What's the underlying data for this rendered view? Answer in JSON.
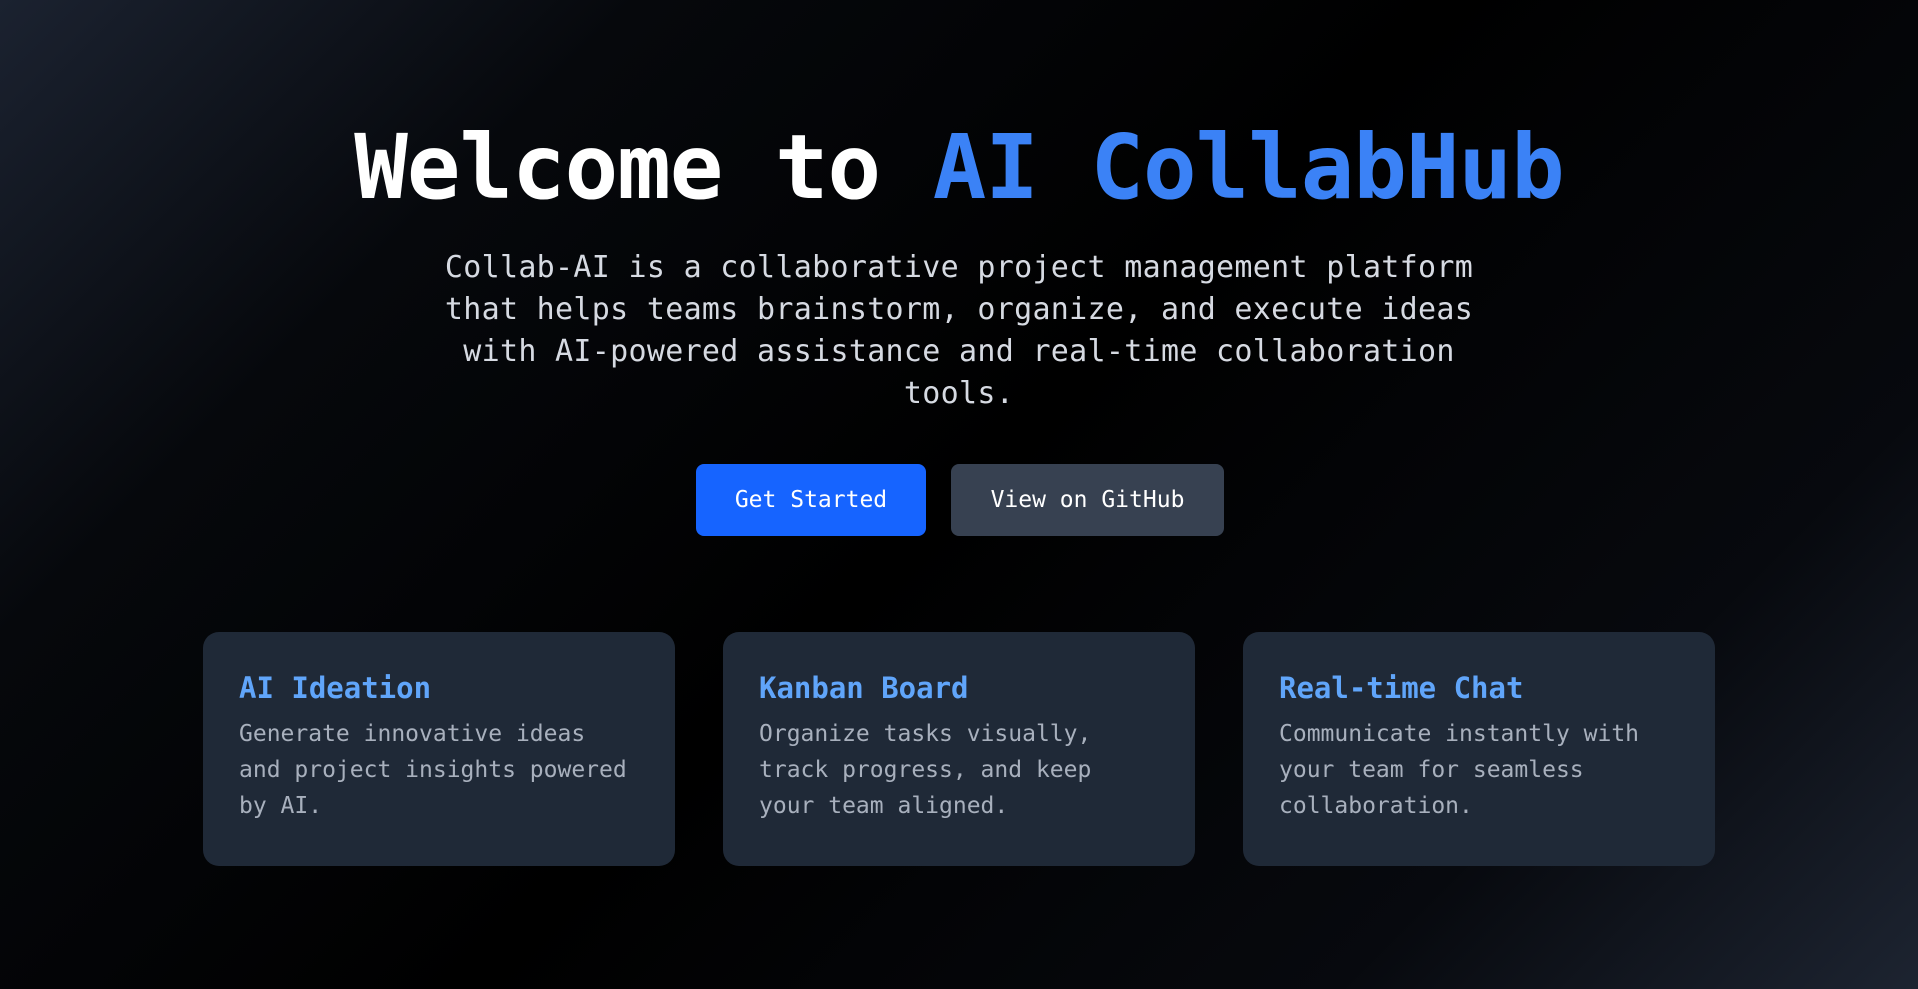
{
  "hero": {
    "title_prefix": "Welcome to ",
    "title_accent": "AI CollabHub",
    "subtitle": "Collab-AI is a collaborative project management platform that helps teams brainstorm, organize, and execute ideas with AI-powered assistance and real-time collaboration tools."
  },
  "actions": {
    "primary_label": "Get Started",
    "secondary_label": "View on GitHub"
  },
  "features": [
    {
      "title": "AI Ideation",
      "description": "Generate innovative ideas and project insights powered by AI."
    },
    {
      "title": "Kanban Board",
      "description": "Organize tasks visually, track progress, and keep your team aligned."
    },
    {
      "title": "Real-time Chat",
      "description": "Communicate instantly with your team for seamless collaboration."
    }
  ],
  "colors": {
    "accent": "#3b82f6",
    "primary_button": "#1664ff",
    "secondary_button": "#374151",
    "card_background": "#1f2937",
    "card_title": "#60a5fa"
  }
}
